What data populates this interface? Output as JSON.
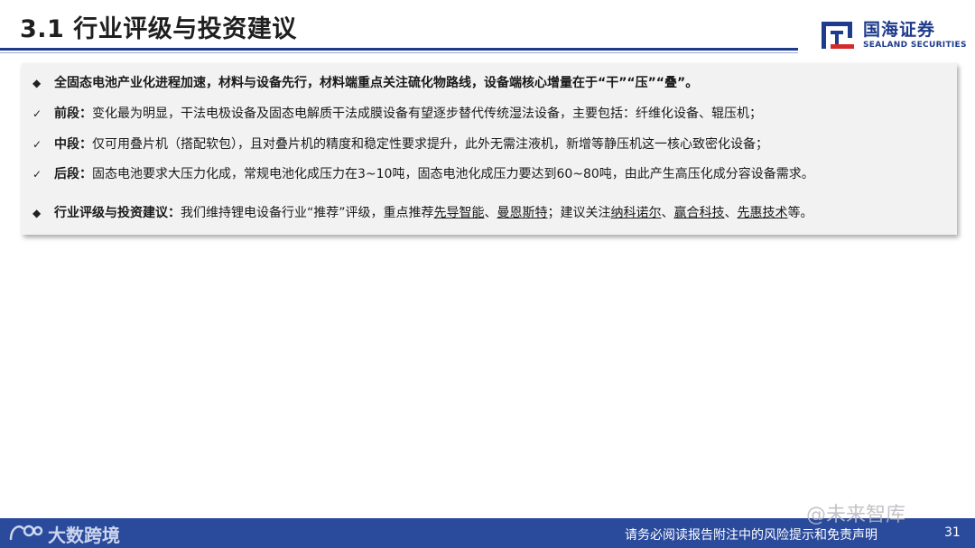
{
  "header": {
    "title": "3.1 行业评级与投资建议",
    "logo_cn": "国海证券",
    "logo_en": "SEALAND SECURITIES"
  },
  "content": {
    "line1": {
      "bullet": "◆",
      "text": "全固态电池产业化进程加速，材料与设备先行，材料端重点关注硫化物路线，设备端核心增量在于“干”“压”“叠”。"
    },
    "line2": {
      "bullet": "✓",
      "label": "前段：",
      "text": "变化最为明显，干法电极设备及固态电解质干法成膜设备有望逐步替代传统湿法设备，主要包括：纤维化设备、辊压机；"
    },
    "line3": {
      "bullet": "✓",
      "label": "中段：",
      "text": "仅可用叠片机（搭配软包），且对叠片机的精度和稳定性要求提升，此外无需注液机，新增等静压机这一核心致密化设备；"
    },
    "line4": {
      "bullet": "✓",
      "label": "后段：",
      "text": "固态电池要求大压力化成，常规电池化成压力在3~10吨，固态电池化成压力要达到60~80吨，由此产生高压化成分容设备需求。"
    },
    "line5": {
      "bullet": "◆",
      "label": "行业评级与投资建议：",
      "text_a": "我们维持锂电设备行业“推荐”评级，重点推荐",
      "co1": "先导智能",
      "sep1": "、",
      "co2": "曼恩斯特",
      "text_b": "；建议关注",
      "co3": "纳科诺尔",
      "sep2": "、",
      "co4": "赢合科技",
      "sep3": "、",
      "co5": "先惠技术",
      "text_c": "等。"
    }
  },
  "footer": {
    "logo_text": "大数跨境",
    "watermark": "@未来智库",
    "disclaimer": "请务必阅读报告附注中的风险提示和免责声明",
    "page_number": "31"
  },
  "colors": {
    "brand_blue": "#1f3b8c",
    "footer_blue": "#2a4a9c",
    "box_bg": "#f2f2f2"
  }
}
